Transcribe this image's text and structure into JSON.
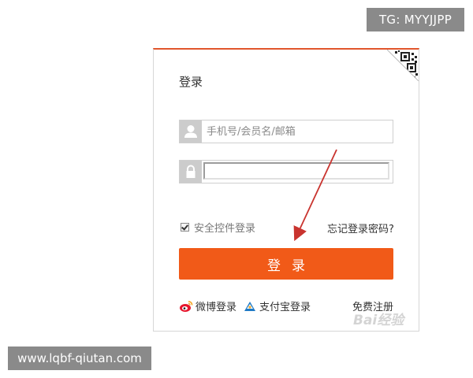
{
  "watermarks": {
    "top_right": "TG: MYYJJPP",
    "bottom_left": "www.lqbf-qiutan.com",
    "baidu": "Bai经验"
  },
  "login": {
    "title": "登录",
    "username_placeholder": "手机号/会员名/邮箱",
    "username_value": "",
    "password_value": "",
    "safe_control_label": "安全控件登录",
    "safe_control_checked": true,
    "forgot_password": "忘记登录密码?",
    "submit_label": "登录",
    "weibo_login": "微博登录",
    "alipay_login": "支付宝登录",
    "register": "免费注册"
  },
  "colors": {
    "accent": "#f15a18",
    "top_border": "#e1562c",
    "annotation_arrow": "#c9342f"
  },
  "icons": {
    "qr": "qr-code-icon",
    "user": "user-icon",
    "lock": "lock-icon",
    "weibo": "weibo-icon",
    "alipay": "alipay-icon"
  }
}
